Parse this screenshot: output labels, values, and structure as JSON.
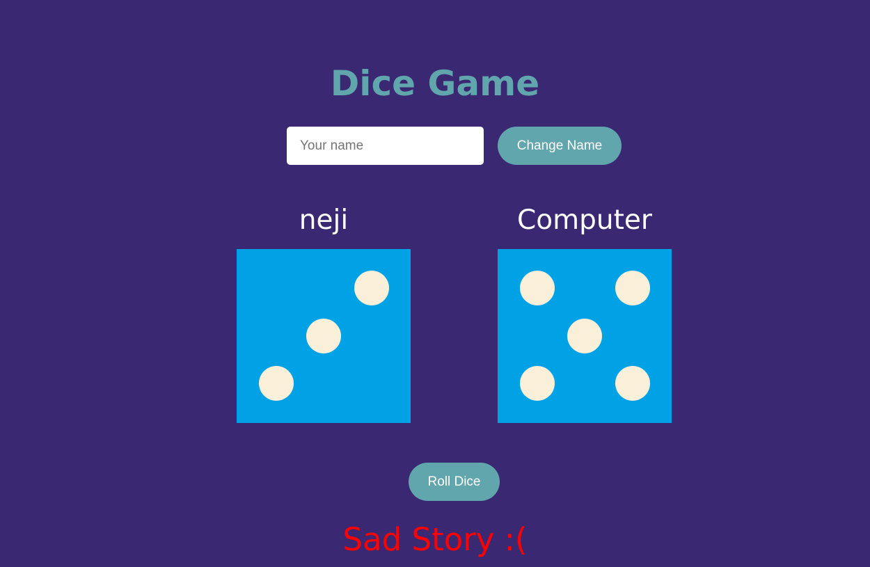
{
  "page": {
    "title": "Dice Game"
  },
  "name_form": {
    "placeholder": "Your name",
    "value": "",
    "change_label": "Change Name"
  },
  "players": [
    {
      "name": "neji",
      "die_value": 3
    },
    {
      "name": "Computer",
      "die_value": 5
    }
  ],
  "controls": {
    "roll_label": "Roll Dice"
  },
  "result": {
    "text": "Sad Story :("
  },
  "colors": {
    "background": "#3b2873",
    "accent": "#62a6ad",
    "die_face": "#00a2e6",
    "pip": "#faf0da",
    "result_text": "#ff0000"
  }
}
